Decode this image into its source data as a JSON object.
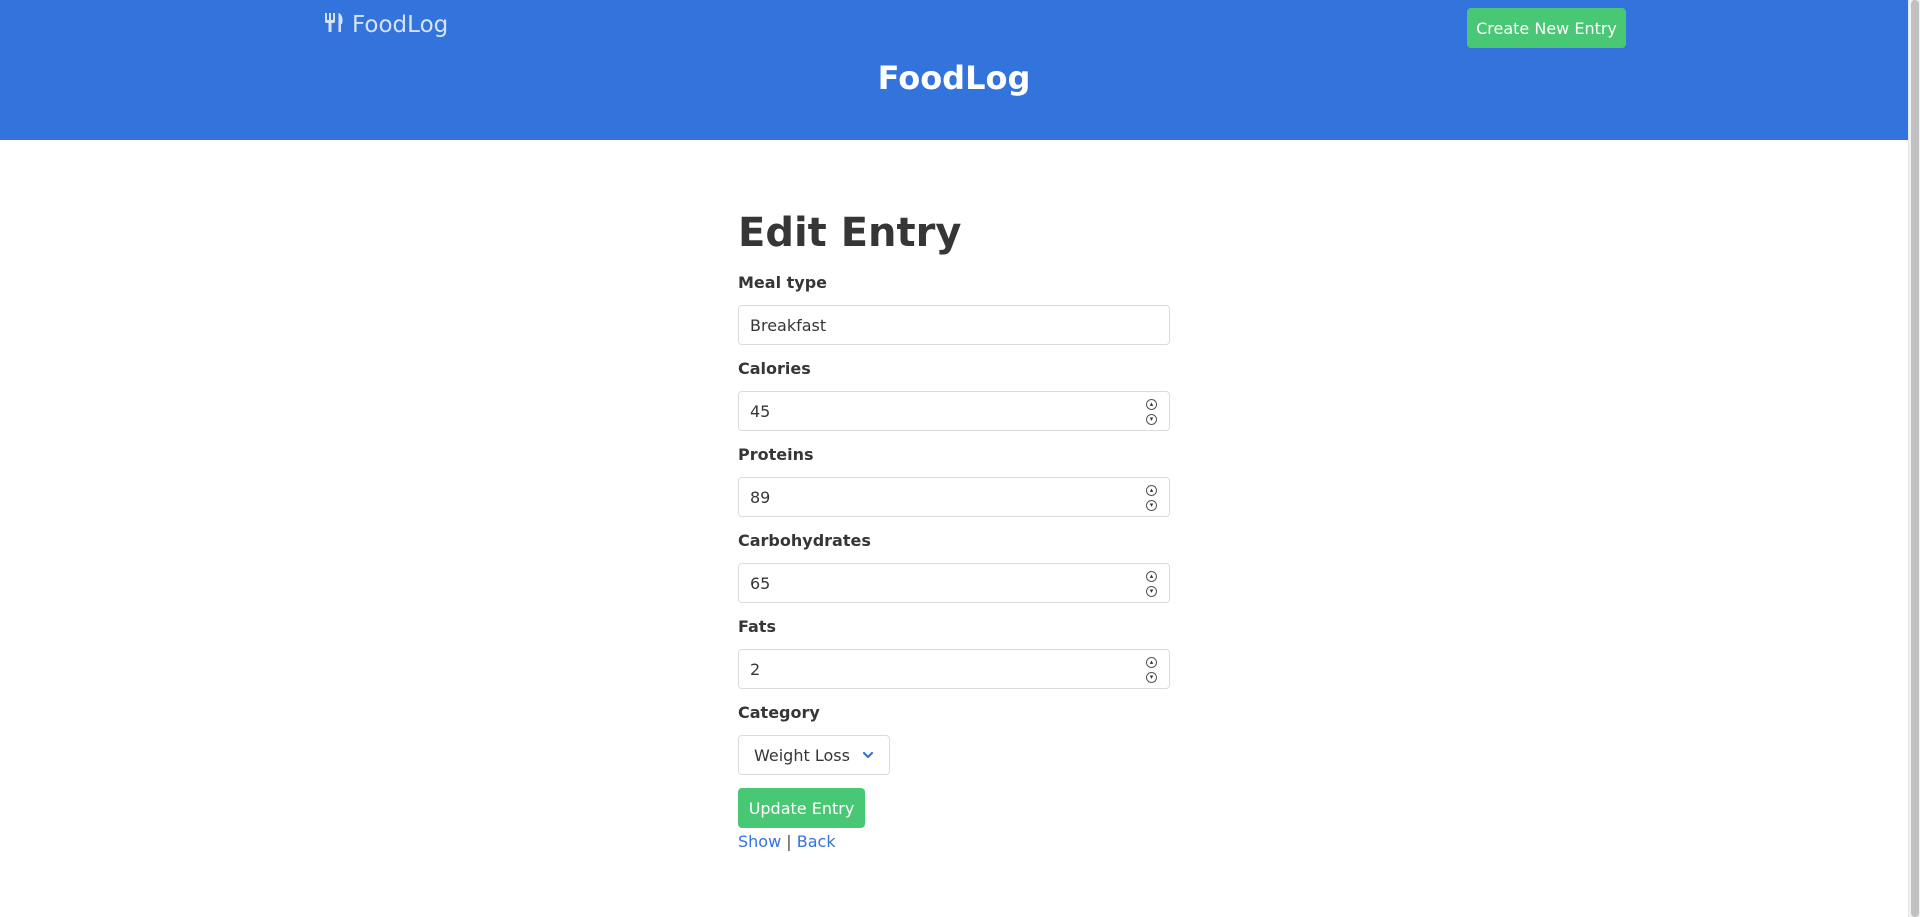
{
  "colors": {
    "header_bg": "#3273dc",
    "success": "#48c774",
    "link": "#3273dc",
    "text": "#363636"
  },
  "navbar": {
    "brand_icon": "utensils-icon",
    "brand_label": "FoodLog",
    "create_button_label": "Create New Entry"
  },
  "hero": {
    "title": "FoodLog"
  },
  "main": {
    "title": "Edit Entry",
    "fields": {
      "meal_type": {
        "label": "Meal type",
        "value": "Breakfast"
      },
      "calories": {
        "label": "Calories",
        "value": "45"
      },
      "proteins": {
        "label": "Proteins",
        "value": "89"
      },
      "carbohydrates": {
        "label": "Carbohydrates",
        "value": "65"
      },
      "fats": {
        "label": "Fats",
        "value": "2"
      },
      "category": {
        "label": "Category",
        "value": "Weight Loss"
      }
    },
    "submit_label": "Update Entry",
    "links": {
      "show": "Show",
      "separator": "|",
      "back": "Back"
    }
  }
}
